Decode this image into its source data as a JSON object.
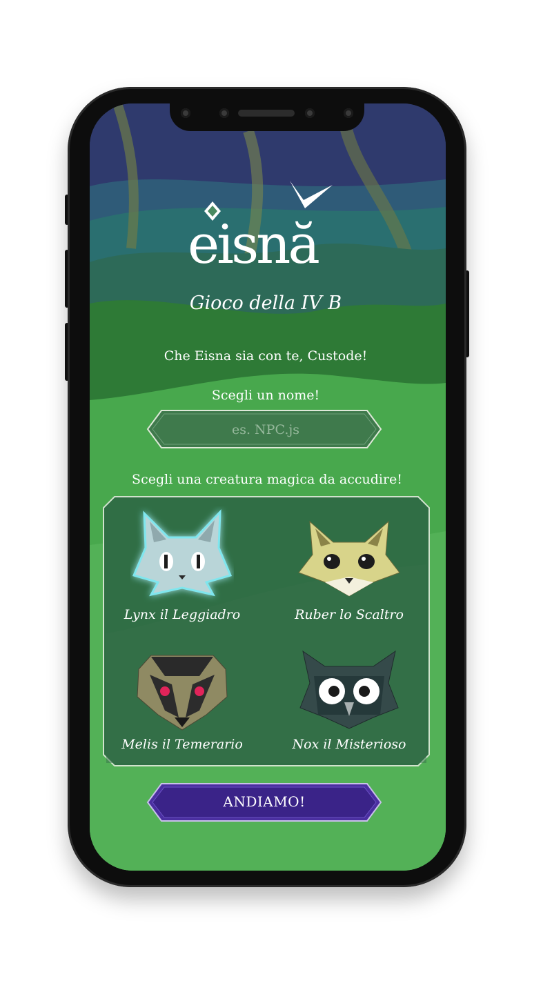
{
  "app": {
    "logo_text": "eisnă",
    "subtitle": "Gioco della IV B",
    "greeting": "Che Eisna sia con te, Custode!"
  },
  "name_form": {
    "label": "Scegli un nome!",
    "placeholder": "es. NPC.js",
    "value": ""
  },
  "creatures": {
    "label": "Scegli una creatura magica da accudire!",
    "items": [
      {
        "name": "Lynx il Leggiadro",
        "icon": "lynx-cat-icon",
        "selected": true
      },
      {
        "name": "Ruber lo Scaltro",
        "icon": "fox-icon",
        "selected": false
      },
      {
        "name": "Melis il Temerario",
        "icon": "badger-icon",
        "selected": false
      },
      {
        "name": "Nox il Misterioso",
        "icon": "owl-icon",
        "selected": false
      }
    ]
  },
  "action": {
    "go_label": "ANDIAMO!"
  },
  "colors": {
    "accent_button": "#4a2fa0",
    "panel": "#2f6b45",
    "text": "#ffffff"
  }
}
